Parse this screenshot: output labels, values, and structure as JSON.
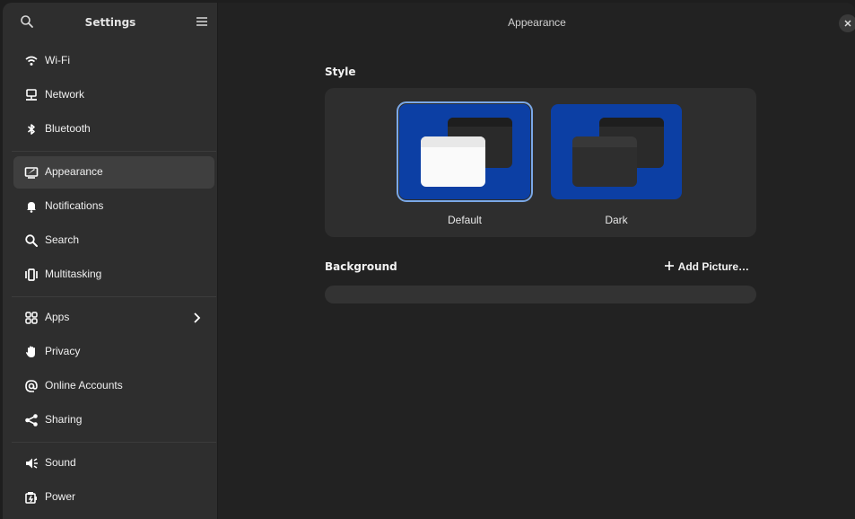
{
  "sidebar": {
    "title": "Settings",
    "items": [
      {
        "label": "Wi-Fi",
        "icon": "wifi-icon"
      },
      {
        "label": "Network",
        "icon": "network-icon"
      },
      {
        "label": "Bluetooth",
        "icon": "bluetooth-icon"
      },
      {
        "label": "Appearance",
        "icon": "appearance-icon",
        "active": true
      },
      {
        "label": "Notifications",
        "icon": "bell-icon"
      },
      {
        "label": "Search",
        "icon": "search-icon"
      },
      {
        "label": "Multitasking",
        "icon": "multitasking-icon"
      },
      {
        "label": "Apps",
        "icon": "apps-icon",
        "has_submenu": true
      },
      {
        "label": "Privacy",
        "icon": "hand-icon"
      },
      {
        "label": "Online Accounts",
        "icon": "at-sign-icon"
      },
      {
        "label": "Sharing",
        "icon": "share-icon"
      },
      {
        "label": "Sound",
        "icon": "speaker-icon"
      },
      {
        "label": "Power",
        "icon": "power-icon"
      }
    ]
  },
  "main": {
    "title": "Appearance",
    "style_section": {
      "label": "Style",
      "options": [
        {
          "caption": "Default",
          "selected": true
        },
        {
          "caption": "Dark",
          "selected": false
        }
      ]
    },
    "background_section": {
      "label": "Background",
      "add_picture_label": "Add Picture…"
    }
  },
  "colors": {
    "accent": "#7aa8e8",
    "theme_preview_bg": "#0c3fa4",
    "sidebar_bg": "#2e2e2e",
    "content_bg": "#222222"
  }
}
